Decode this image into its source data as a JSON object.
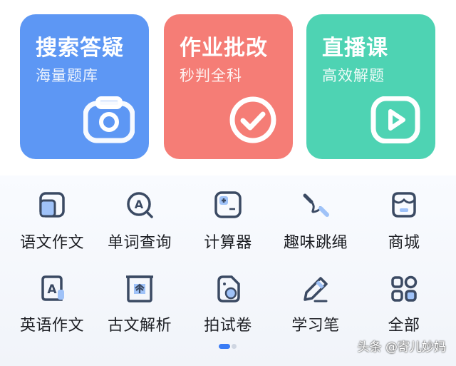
{
  "cards": [
    {
      "title": "搜索答疑",
      "subtitle": "海量题库",
      "color": "#5d97f4",
      "icon": "camera-icon"
    },
    {
      "title": "作业批改",
      "subtitle": "秒判全科",
      "color": "#f57d76",
      "icon": "check-icon"
    },
    {
      "title": "直播课",
      "subtitle": "高效解题",
      "color": "#4ed3b3",
      "icon": "play-icon"
    }
  ],
  "tools": [
    {
      "label": "语文作文",
      "icon": "notebook-icon"
    },
    {
      "label": "单词查询",
      "icon": "word-search-icon"
    },
    {
      "label": "计算器",
      "icon": "calculator-icon"
    },
    {
      "label": "趣味跳绳",
      "icon": "jump-rope-icon"
    },
    {
      "label": "商城",
      "icon": "store-icon"
    },
    {
      "label": "英语作文",
      "icon": "english-doc-icon"
    },
    {
      "label": "古文解析",
      "icon": "scroll-icon"
    },
    {
      "label": "拍试卷",
      "icon": "paper-camera-icon"
    },
    {
      "label": "学习笔",
      "icon": "pen-icon"
    },
    {
      "label": "全部",
      "icon": "grid-icon"
    }
  ],
  "pager": {
    "active": 1,
    "total": 2
  },
  "watermark": "头条 @寄儿妙妈",
  "colors": {
    "icon_stroke": "#3b4a63",
    "accent": "#3a7cf5"
  }
}
